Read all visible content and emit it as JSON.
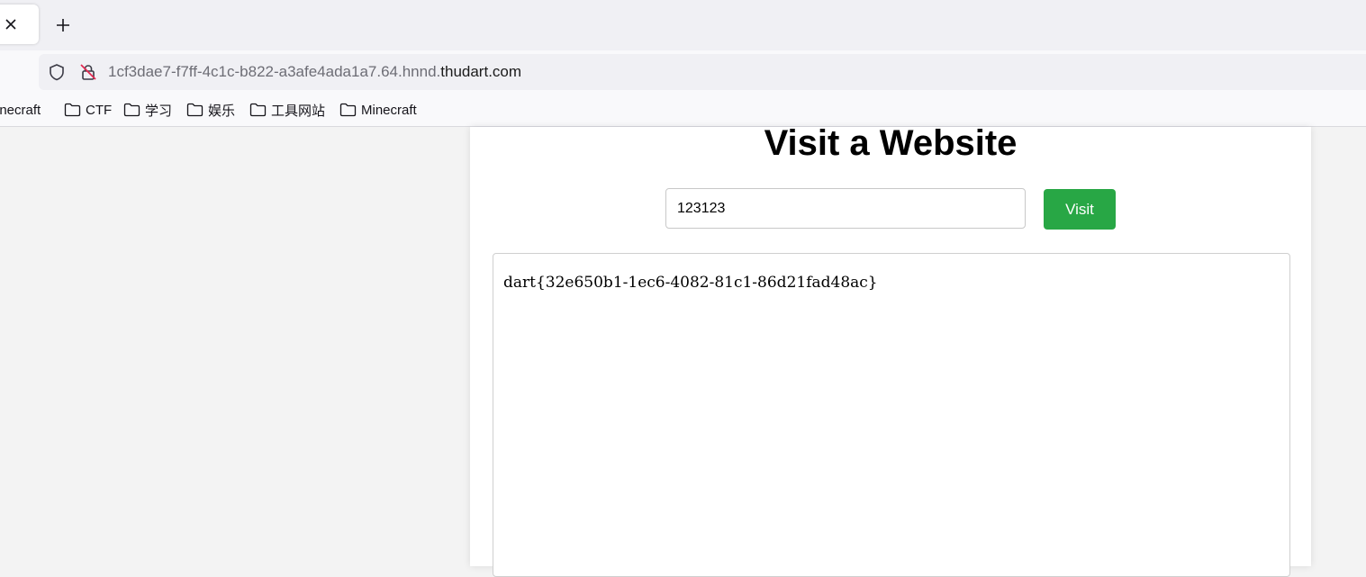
{
  "browser": {
    "tab_close_icon": "close-icon",
    "new_tab_icon": "plus-icon",
    "url": {
      "subdomain": "1cf3dae7-f7ff-4c1c-b822-a3afe4ada1a7.64.hnnd.",
      "domain": "thudart.com"
    },
    "bookmarks": [
      "inecraft",
      "CTF",
      "学习",
      "娱乐",
      "工具网站",
      "Minecraft"
    ]
  },
  "page": {
    "title": "Visit a Website",
    "input_value": "123123",
    "visit_label": "Visit",
    "result_text": "dart{32e650b1-1ec6-4082-81c1-86d21fad48ac}"
  },
  "colors": {
    "accent": "#28a745",
    "background": "#f3f3f3",
    "card": "#ffffff"
  }
}
